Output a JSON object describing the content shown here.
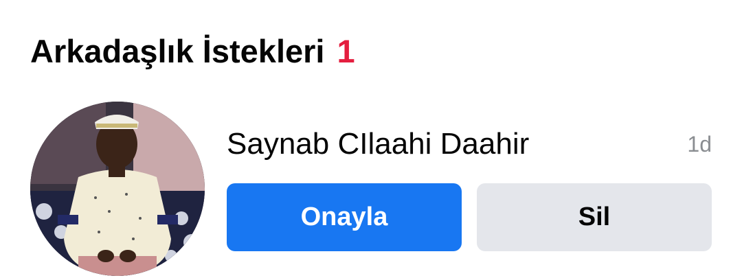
{
  "header": {
    "title": "Arkadaşlık İstekleri",
    "count": "1"
  },
  "requests": [
    {
      "name": "Saynab CIlaahi Daahir",
      "time": "1d",
      "confirm_label": "Onayla",
      "delete_label": "Sil",
      "avatar": "profile-photo"
    }
  ],
  "colors": {
    "accent": "#1877f2",
    "badge": "#e41e3f",
    "secondary_button": "#e4e6eb",
    "muted_text": "#8a8d91"
  }
}
